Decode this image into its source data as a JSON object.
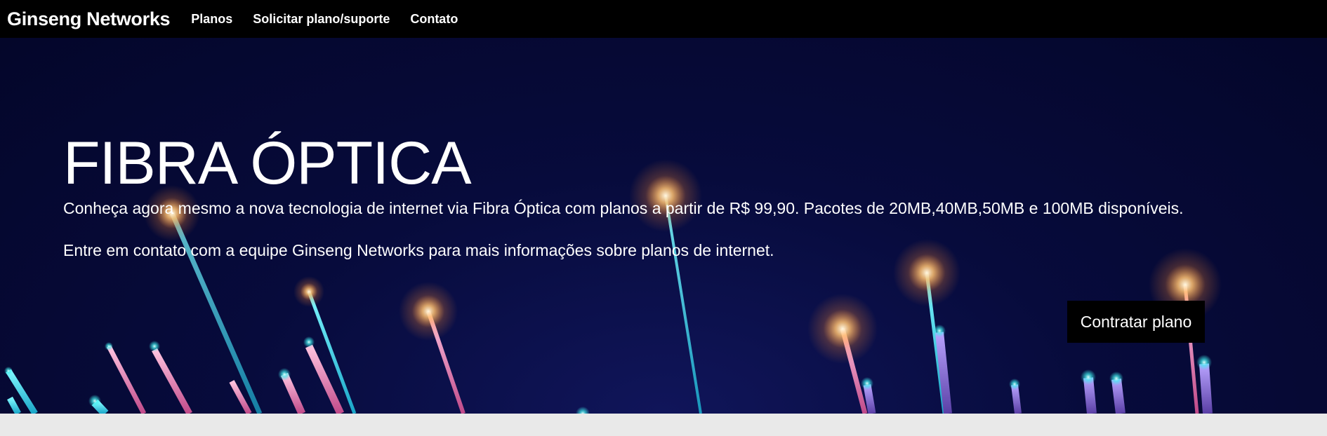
{
  "navbar": {
    "brand": "Ginseng Networks",
    "links": [
      "Planos",
      "Solicitar plano/suporte",
      "Contato"
    ]
  },
  "hero": {
    "title": "FIBRA ÓPTICA",
    "paragraph1": "Conheça agora mesmo a nova tecnologia de internet via Fibra Óptica com planos a partir de R$ 99,90. Pacotes de 20MB,40MB,50MB e 100MB disponíveis.",
    "paragraph2": "Entre em contato com a equipe Ginseng Networks para mais informações sobre planos de internet.",
    "cta_label": "Contratar plano",
    "background_image": "optical-fiber-strands-glowing"
  },
  "colors": {
    "navbar_bg": "#000000",
    "hero_bg": "#070b3c",
    "text": "#ffffff",
    "cta_bg": "#000000",
    "page_bg": "#e9e9e9"
  }
}
